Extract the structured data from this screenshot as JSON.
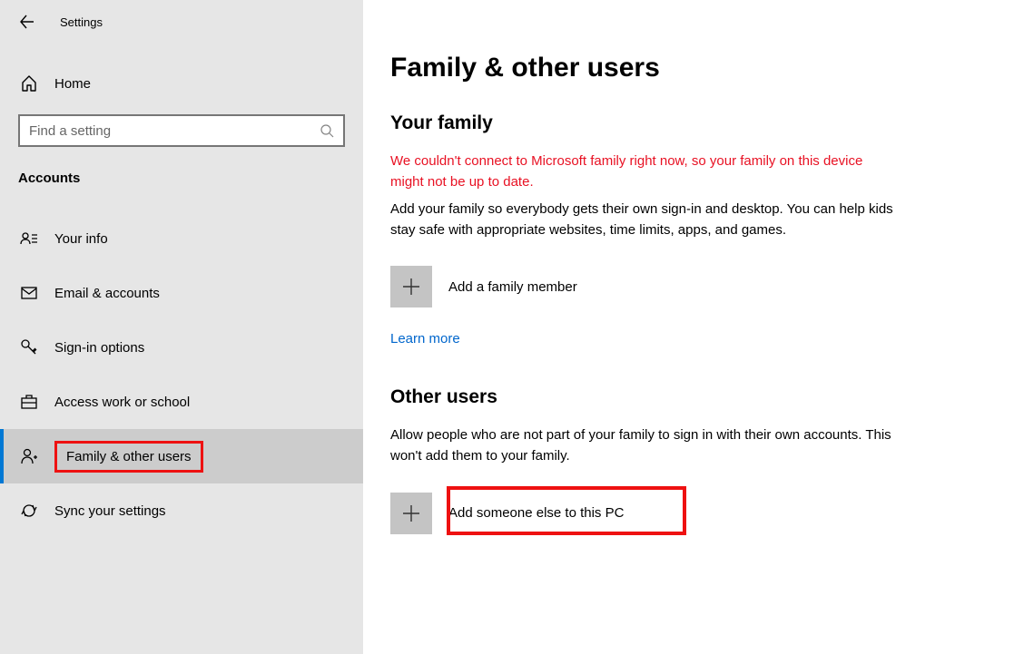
{
  "header": {
    "app_title": "Settings",
    "home_label": "Home",
    "search_placeholder": "Find a setting",
    "category": "Accounts"
  },
  "sidebar": {
    "items": [
      {
        "label": "Your info",
        "icon": "user-card"
      },
      {
        "label": "Email & accounts",
        "icon": "mail"
      },
      {
        "label": "Sign-in options",
        "icon": "key"
      },
      {
        "label": "Access work or school",
        "icon": "briefcase"
      },
      {
        "label": "Family & other users",
        "icon": "user-plus",
        "selected": true
      },
      {
        "label": "Sync your settings",
        "icon": "sync"
      }
    ]
  },
  "main": {
    "page_title": "Family & other users",
    "family": {
      "title": "Your family",
      "warning": "We couldn't connect to Microsoft family right now, so your family on this device might not be up to date.",
      "description": "Add your family so everybody gets their own sign-in and desktop. You can help kids stay safe with appropriate websites, time limits, apps, and games.",
      "add_label": "Add a family member",
      "learn_more": "Learn more"
    },
    "other": {
      "title": "Other users",
      "description": "Allow people who are not part of your family to sign in with their own accounts. This won't add them to your family.",
      "add_label": "Add someone else to this PC"
    }
  }
}
